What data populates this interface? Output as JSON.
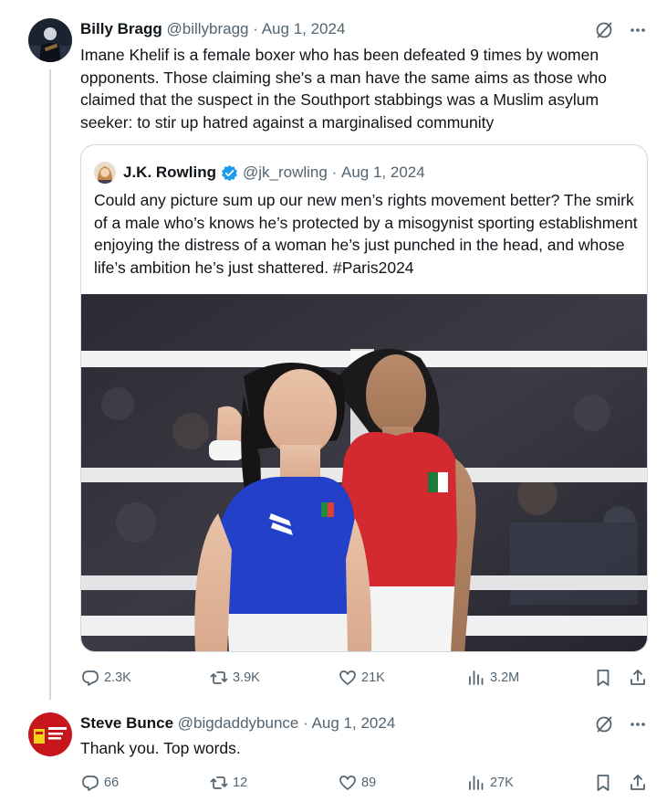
{
  "tweet1": {
    "author_name": "Billy Bragg",
    "handle": "@billybragg",
    "separator": "·",
    "date": "Aug 1, 2024",
    "text": "Imane Khelif is a female boxer who has been defeated 9 times by women opponents. Those claiming she's a man have the same aims as those who claimed that the suspect in the Southport stabbings was a Muslim asylum seeker: to stir up hatred against a marginalised community",
    "quote": {
      "author_name": "J.K. Rowling",
      "handle": "@jk_rowling",
      "separator": "·",
      "date": "Aug 1, 2024",
      "text": "Could any picture sum up our new men’s rights movement better? The smirk of a male who’s knows he’s protected by a misogynist sporting establishment enjoying the distress of a woman he’s just punched in the head, and whose life’s ambition he’s just shattered. #Paris2024"
    },
    "actions": {
      "replies": "2.3K",
      "reposts": "3.9K",
      "likes": "21K",
      "views": "3.2M"
    }
  },
  "tweet2": {
    "author_name": "Steve Bunce",
    "handle": "@bigdaddybunce",
    "separator": "·",
    "date": "Aug 1, 2024",
    "text": "Thank you. Top words.",
    "actions": {
      "replies": "66",
      "reposts": "12",
      "likes": "89",
      "views": "27K"
    }
  },
  "icons": [
    "grok-icon",
    "more-icon",
    "verified-badge-icon",
    "reply-icon",
    "repost-icon",
    "like-icon",
    "views-icon",
    "bookmark-icon",
    "share-icon"
  ],
  "colors": {
    "text": "#0f1419",
    "secondary": "#536471",
    "border": "#cfd9de",
    "verified": "#1d9bf0"
  }
}
